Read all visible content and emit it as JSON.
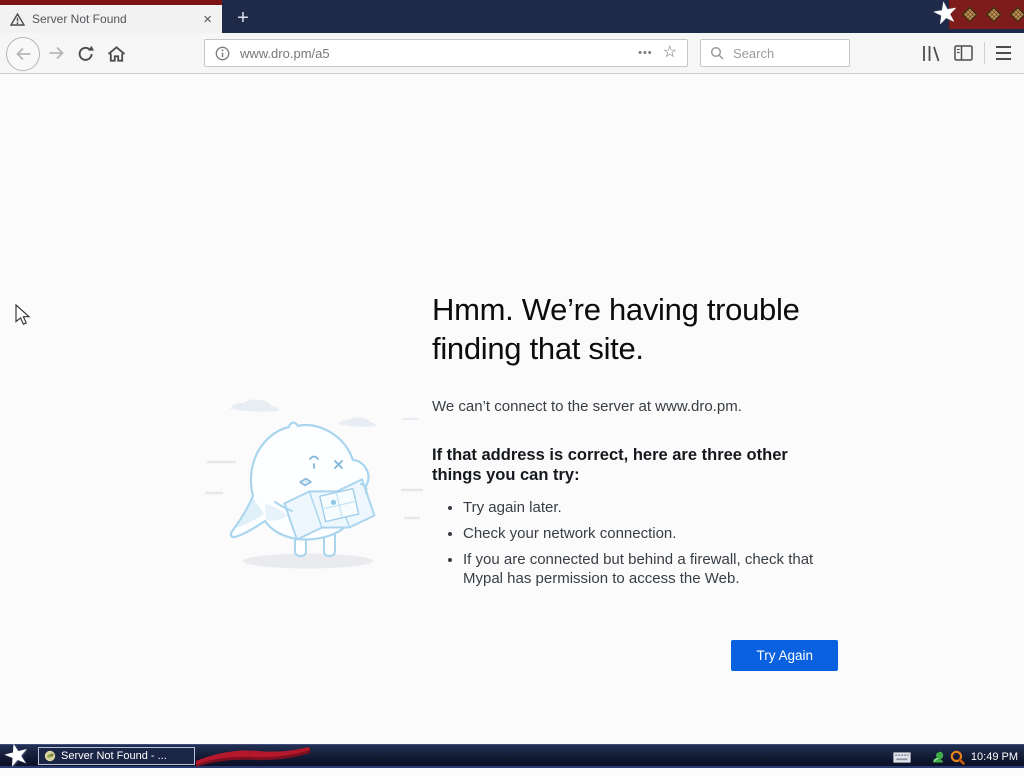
{
  "browser_window": {
    "tab": {
      "title": "Server Not Found"
    },
    "toolbar": {
      "url": "www.dro.pm/a5",
      "search_placeholder": "Search"
    }
  },
  "icons": {
    "new_tab": "+",
    "close_tab": "×",
    "page_actions": "•••",
    "bookmark_star": "☆",
    "titlebar_star": "★",
    "start_star": "★"
  },
  "error_page": {
    "heading": "Hmm. We’re having trouble finding that site.",
    "message": "We can’t connect to the server at www.dro.pm.",
    "advice_heading": "If that address is correct, here are three other things you can try:",
    "suggestions": [
      "Try again later.",
      "Check your network connection.",
      "If you are connected but behind a firewall, check that Mypal has permission to access the Web."
    ],
    "try_again": "Try Again"
  },
  "colors": {
    "accent_blue": "#0a61df",
    "titlebar_navy": "#1e2a47",
    "titlebar_red": "#7d1315",
    "taskbar_flag_red": "#b5182b"
  },
  "taskbar": {
    "task_button": "Server Not Found - ...",
    "clock": "10:49 PM"
  }
}
